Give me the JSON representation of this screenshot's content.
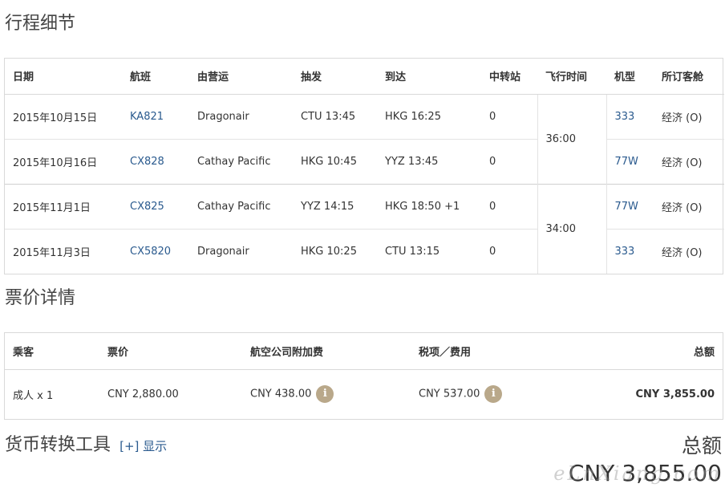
{
  "itinerary": {
    "title": "行程细节",
    "headers": [
      "日期",
      "航班",
      "由营运",
      "抽发",
      "到达",
      "中转站",
      "飞行时间",
      "机型",
      "所订客舱"
    ],
    "groups": [
      {
        "duration": "36:00",
        "rows": [
          {
            "date": "2015年10月15日",
            "flight": "KA821",
            "operator": "Dragonair",
            "depart": "CTU 13:45",
            "arrive": "HKG 16:25",
            "stops": "0",
            "aircraft": "333",
            "cabin": "经济 (O)"
          },
          {
            "date": "2015年10月16日",
            "flight": "CX828",
            "operator": "Cathay Pacific",
            "depart": "HKG 10:45",
            "arrive": "YYZ 13:45",
            "stops": "0",
            "aircraft": "77W",
            "cabin": "经济 (O)"
          }
        ]
      },
      {
        "duration": "34:00",
        "rows": [
          {
            "date": "2015年11月1日",
            "flight": "CX825",
            "operator": "Cathay Pacific",
            "depart": "YYZ 14:15",
            "arrive": "HKG 18:50 +1",
            "stops": "0",
            "aircraft": "77W",
            "cabin": "经济 (O)"
          },
          {
            "date": "2015年11月3日",
            "flight": "CX5820",
            "operator": "Dragonair",
            "depart": "HKG 10:25",
            "arrive": "CTU 13:15",
            "stops": "0",
            "aircraft": "333",
            "cabin": "经济 (O)"
          }
        ]
      }
    ]
  },
  "fare": {
    "title": "票价详情",
    "headers": {
      "passenger": "乘客",
      "fare": "票价",
      "surcharge": "航空公司附加费",
      "taxes": "税项／费用",
      "total": "总额"
    },
    "row": {
      "passenger": "成人 x 1",
      "fare": "CNY 2,880.00",
      "surcharge": "CNY 438.00",
      "taxes": "CNY 537.00",
      "total": "CNY 3,855.00"
    },
    "info_icon": "i"
  },
  "currency_tool": {
    "title": "货币转换工具",
    "toggle_label": "[+] 显示"
  },
  "summary": {
    "total_label": "总额",
    "total_value": "CNY 3,855.00"
  },
  "watermark": "eLnXiang.com",
  "colors": {
    "link": "#2a5a8e",
    "info_icon": "#b9a88a",
    "border": "#d9d9d9"
  }
}
